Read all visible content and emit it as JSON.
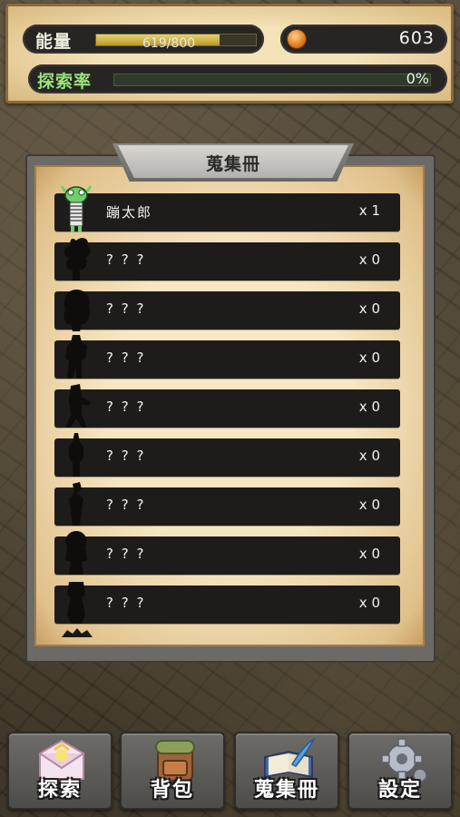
{
  "status": {
    "energy_label": "能量",
    "energy_text": "619/800",
    "energy_fraction": 0.774,
    "coin_value": "603",
    "explore_label": "探索率",
    "explore_text": "0%",
    "explore_fraction": 0.0
  },
  "collection": {
    "title": "蒐集冊",
    "items": [
      {
        "name": "蹦太郎",
        "count": "x 1",
        "discovered": true
      },
      {
        "name": "? ? ?",
        "count": "x 0",
        "discovered": false
      },
      {
        "name": "? ? ?",
        "count": "x 0",
        "discovered": false
      },
      {
        "name": "? ? ?",
        "count": "x 0",
        "discovered": false
      },
      {
        "name": "? ? ?",
        "count": "x 0",
        "discovered": false
      },
      {
        "name": "? ? ?",
        "count": "x 0",
        "discovered": false
      },
      {
        "name": "? ? ?",
        "count": "x 0",
        "discovered": false
      },
      {
        "name": "? ? ?",
        "count": "x 0",
        "discovered": false
      },
      {
        "name": "? ? ?",
        "count": "x 0",
        "discovered": false
      }
    ]
  },
  "nav": {
    "explore": "探索",
    "backpack": "背包",
    "collection": "蒐集冊",
    "settings": "設定"
  },
  "icons": {
    "coin": "coin-icon",
    "explore": "envelope-icon",
    "backpack": "backpack-icon",
    "collection": "book-quill-icon",
    "settings": "gear-icon"
  }
}
